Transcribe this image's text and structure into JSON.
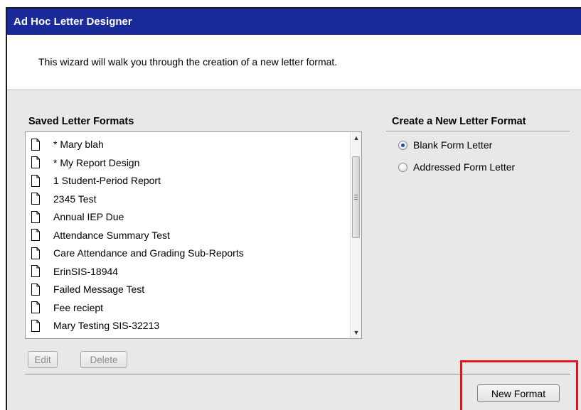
{
  "window": {
    "title": "Ad Hoc Letter Designer"
  },
  "intro": {
    "text": "This wizard will walk you through the creation of a new letter format."
  },
  "saved": {
    "title": "Saved Letter Formats",
    "items": [
      "* Mary blah",
      "* My Report Design",
      "1 Student-Period Report",
      "2345 Test",
      "Annual IEP Due",
      "Attendance Summary Test",
      "Care Attendance and Grading Sub-Reports",
      "ErinSIS-18944",
      "Failed Message Test",
      "Fee reciept",
      "Mary Testing SIS-32213"
    ],
    "icon": "document-icon"
  },
  "create": {
    "title": "Create a New Letter Format",
    "options": [
      {
        "label": "Blank Form Letter",
        "checked": true
      },
      {
        "label": "Addressed Form Letter",
        "checked": false
      }
    ]
  },
  "buttons": {
    "edit": "Edit",
    "delete": "Delete",
    "new_format": "New Format"
  },
  "colors": {
    "titlebar": "#1a2a99",
    "highlight": "#e3141b",
    "radio_selected": "#1b4fa8"
  }
}
